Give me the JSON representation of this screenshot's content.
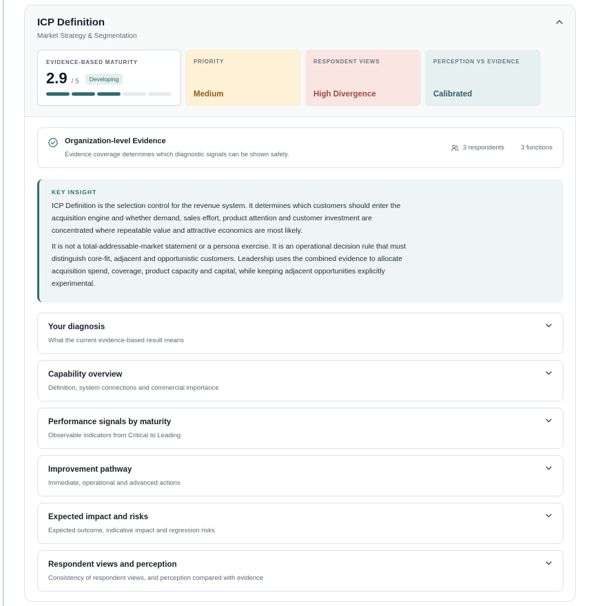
{
  "header": {
    "title": "ICP Definition",
    "subtitle": "Market Strategy & Segmentation"
  },
  "metrics": {
    "maturity": {
      "label": "Evidence-based maturity",
      "score": "2.9",
      "max": "/ 5",
      "badge": "Developing",
      "progress_segments_filled": 3,
      "progress_segments_total": 5
    },
    "priority": {
      "label": "Priority",
      "value": "Medium"
    },
    "respondent_views": {
      "label": "Respondent views",
      "value": "High Divergence"
    },
    "perception": {
      "label": "Perception vs evidence",
      "value": "Calibrated"
    }
  },
  "evidence": {
    "title": "Organization-level Evidence",
    "subtitle": "Evidence coverage determines which diagnostic signals can be shown safely.",
    "respondents": "3 respondents",
    "functions": "3 functions"
  },
  "insight": {
    "label": "Key insight",
    "paragraph_1": "ICP Definition is the selection control for the revenue system. It determines which customers should enter the acquisition engine and whether demand, sales effort, product attention and customer investment are concentrated where repeatable value and attractive economics are most likely.",
    "paragraph_2": "It is not a total-addressable-market statement or a persona exercise. It is an operational decision rule that must distinguish core-fit, adjacent and opportunistic customers. Leadership uses the combined evidence to allocate acquisition spend, coverage, product capacity and capital, while keeping adjacent opportunities explicitly experimental."
  },
  "sections": [
    {
      "title": "Your diagnosis",
      "subtitle": "What the current evidence-based result means"
    },
    {
      "title": "Capability overview",
      "subtitle": "Definition, system connections and commercial importance"
    },
    {
      "title": "Performance signals by maturity",
      "subtitle": "Observable indicators from Critical to Leading"
    },
    {
      "title": "Improvement pathway",
      "subtitle": "Immediate, operational and advanced actions"
    },
    {
      "title": "Expected impact and risks",
      "subtitle": "Expected outcome, indicative impact and regression risks"
    },
    {
      "title": "Respondent views and perception",
      "subtitle": "Consistency of respondent views, and perception compared with evidence"
    }
  ],
  "colors": {
    "accent": "#2e6d72",
    "priority_bg": "#fdf1d6",
    "views_bg": "#f9e6e3",
    "perception_bg": "#e6f0f0"
  }
}
